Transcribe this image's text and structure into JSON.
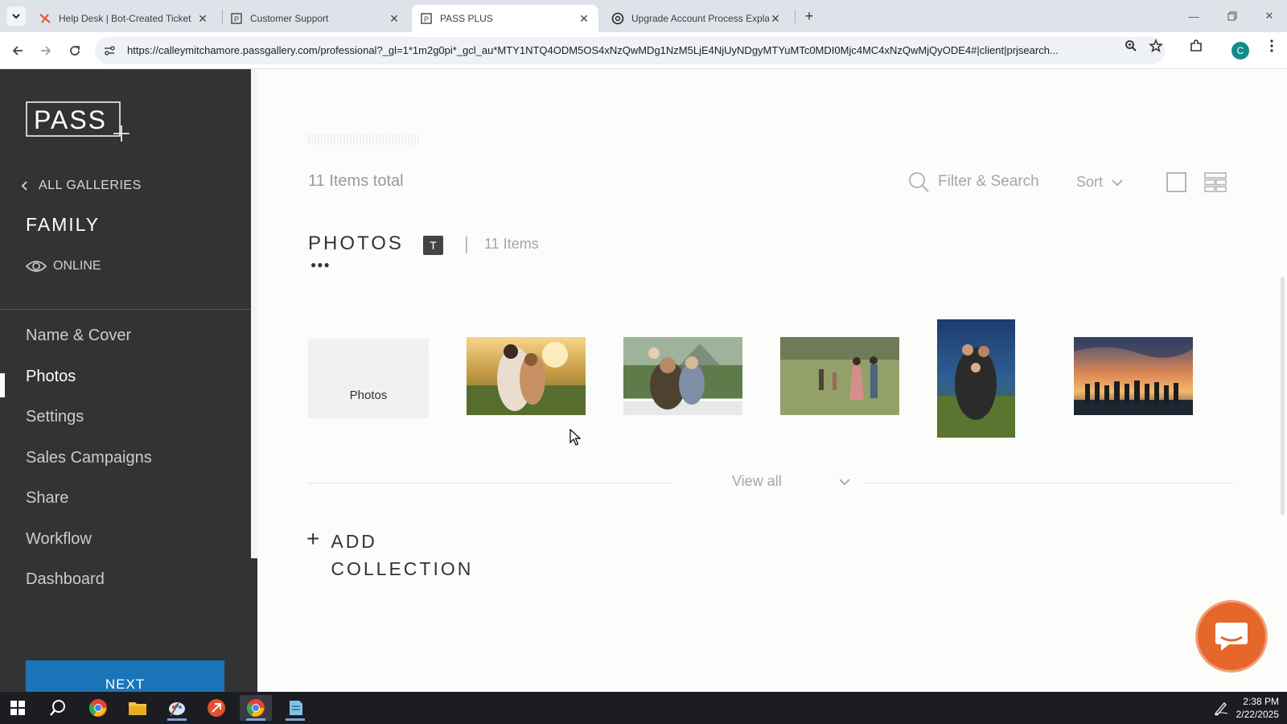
{
  "browser": {
    "tabs": [
      {
        "title": "Help Desk | Bot-Created Ticket",
        "icon": "zendesk-icon"
      },
      {
        "title": "Customer Support",
        "icon": "pass-icon"
      },
      {
        "title": "PASS PLUS",
        "icon": "pass-icon",
        "active": true
      },
      {
        "title": "Upgrade Account Process Expla",
        "icon": "openai-icon"
      }
    ],
    "url": "https://calleymitchamore.passgallery.com/professional?_gl=1*1m2g0pi*_gcl_au*MTY1NTQ4ODM5OS4xNzQwMDg1NzM5LjE4NjUyNDgyMTYuMTc0MDI0Mjc4MC4xNzQwMjQyODE4#|client|prjsearch...",
    "avatar_letter": "C"
  },
  "sidebar": {
    "logo_text": "PASS",
    "back_label": "ALL GALLERIES",
    "gallery_name": "FAMILY",
    "status": "ONLINE",
    "menu": [
      {
        "label": "Name & Cover"
      },
      {
        "label": "Photos",
        "active": true
      },
      {
        "label": "Settings"
      },
      {
        "label": "Sales Campaigns"
      },
      {
        "label": "Share"
      },
      {
        "label": "Workflow"
      },
      {
        "label": "Dashboard"
      }
    ],
    "next_label": "NEXT"
  },
  "main": {
    "items_total": "11 Items total",
    "filter_placeholder": "Filter & Search",
    "sort_label": "Sort",
    "section": {
      "title": "PHOTOS",
      "badge": "T",
      "dots": "●●●",
      "count": "11 Items"
    },
    "placeholder_label": "Photos",
    "view_all": "View all",
    "add_collection": "ADD COLLECTION"
  },
  "taskbar": {
    "time": "2:38 PM",
    "date": "2/22/2025"
  }
}
